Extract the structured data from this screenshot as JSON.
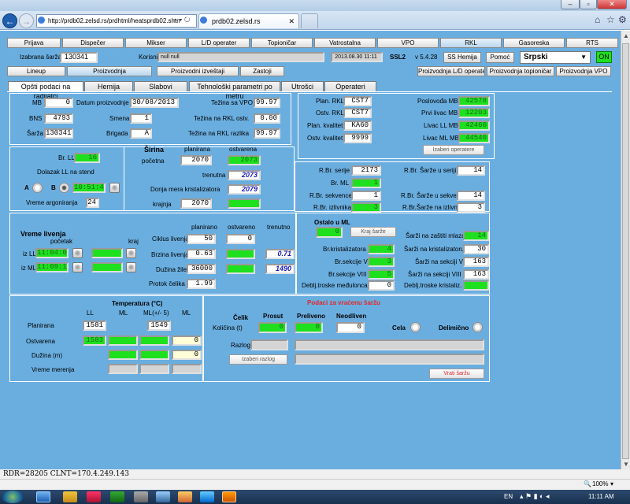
{
  "browser": {
    "url": "http://prdb02.zelsd.rs/prdhtml/heatsprdb02.shtn",
    "tab_title": "prdb02.zelsd.rs",
    "minimize": "–",
    "maximize": "▫",
    "close": "✕"
  },
  "topmenu": [
    "Prijava",
    "Dispečer",
    "Mikser",
    "L/D operater",
    "Topioničar",
    "Vatrostalna",
    "VPO",
    "RKL",
    "Gasoreska",
    "RTS"
  ],
  "header": {
    "izabrana_sarza_label": "Izabrana šarža",
    "izabrana_sarza": "130341",
    "korisnik_label": "Korisnik",
    "korisnik": "null null",
    "datetime": "2013.08.30 11:11",
    "system": "SSL2",
    "version": "v 5.4.28",
    "ss_hemija": "SS Hemija",
    "pomoc": "Pomoć",
    "language": "Srpski",
    "status": "ON"
  },
  "menu2": [
    "Lineup",
    "Proizvodnja",
    "Proizvodni izveštaji",
    "Zastoji"
  ],
  "menu2_right": [
    "Proizvodnja L/D operater",
    "Proizvodnja topioničar",
    "Proizvodnja VPO"
  ],
  "subtabs": [
    "Opšti podaci na radijalci",
    "Hemija",
    "Slabovi",
    "Tehnološki parametri po metru",
    "Utrošci",
    "Operateri"
  ],
  "general": {
    "mb_label": "MB",
    "mb": "0",
    "datum_label": "Datum proizvodnje",
    "datum": "30/08/2013",
    "tezina_vpo_label": "Težina sa VPO",
    "tezina_vpo": "99.97",
    "bns_label": "BNS",
    "bns": "4793",
    "smena_label": "Smena",
    "smena": "1",
    "tezina_rkl_ostv_label": "Težina na RKL ostv.",
    "tezina_rkl_ostv": "0.00",
    "sarza_label": "Šarža",
    "sarza": "130341",
    "brigada_label": "Brigada",
    "brigada": "A",
    "tezina_rkl_razlika_label": "Težina na RKL razlika",
    "tezina_rkl_razlika": "99.97"
  },
  "plan": {
    "plan_rkl_label": "Plan. RKL",
    "plan_rkl": "CST7",
    "ostv_rkl_label": "Ostv. RKL",
    "ostv_rkl": "CST7",
    "plan_kvalitet_label": "Plan. kvalitet",
    "plan_kvalitet": "KA60",
    "ostv_kvalitet_label": "Ostv. kvalitet",
    "ostv_kvalitet": "9999",
    "poslovodja_label": "Poslovođa MB",
    "poslovodja": "42578",
    "prvi_livac_label": "Prvi livac MB",
    "prvi_livac": "12203",
    "livac_ll_label": "Livac LL MB",
    "livac_ll": "42460",
    "livac_ml_label": "Livac ML MB",
    "livac_ml": "44540",
    "izaberi_operatere": "Izaberi operatere"
  },
  "stend": {
    "br_ll_label": "Br. LL",
    "br_ll": "16",
    "dolazak_label": "Dolazak LL na stend",
    "a_label": "A",
    "b_label": "B",
    "dolazak_time": "10:51:44",
    "vreme_argon_label": "Vreme argoniranja",
    "vreme_argon": "24"
  },
  "sirina": {
    "title": "Širina",
    "planirana_label": "planirana",
    "ostvarena_label": "ostvarena",
    "pocetna_label": "početna",
    "pocetna_plan": "2070",
    "pocetna_ostv": "2073",
    "trenutna_label": "trenutna",
    "trenutna": "2073",
    "donja_label": "Donja mera kristalizatora",
    "donja": "2079",
    "krajnja_label": "krajnja",
    "krajnja_plan": "2070",
    "krajnja_ostv": ""
  },
  "serije": {
    "rbr_serije_label": "R.Br. serije",
    "rbr_serije": "2173",
    "rbr_sarze_seriji_label": "R.Br. Šarže u seriji",
    "rbr_sarze_seriji": "14",
    "br_ml_label": "Br. ML",
    "br_ml": "1",
    "rbr_sekvence_label": "R.Br. sekvence",
    "rbr_sekvence": "1",
    "rbr_sarze_sekvenci_label": "R.Br. Šarže u sekvenci",
    "rbr_sarze_sekvenci": "14",
    "rbr_izlivnika_label": "R.Br. izlivnika",
    "rbr_izlivnika": "3",
    "rbr_sarze_izlivniku_label": "R.Br.Šarže na izlivniku",
    "rbr_sarze_izlivniku": "3"
  },
  "livenje": {
    "title": "Vreme livenja",
    "pocetak_label": "početak",
    "kraj_label": "kraj",
    "iz_ll_label": "iz LL",
    "iz_ll": "11:04:05",
    "iz_ll_kraj": "",
    "iz_ml_label": "iz ML",
    "iz_ml": "11:09:15",
    "iz_ml_kraj": "",
    "planirano_label": "planirano",
    "ostvareno_label": "ostvareno",
    "trenutno_label": "trenutno",
    "ciklus_label": "Ciklus livenja",
    "ciklus_plan": "50",
    "ciklus_ostv": "0",
    "brzina_label": "Brzina livenja",
    "brzina_plan": "0.63",
    "brzina_ostv": "",
    "brzina_tren": "0.71",
    "duzina_label": "Dužina žile",
    "duzina_plan": "36000",
    "duzina_ostv": "",
    "duzina_tren": "1490",
    "protok_label": "Protok čelika",
    "protok": "1.99"
  },
  "ostalo": {
    "title": "Ostalo u ML",
    "value": "0",
    "kraj_sarze": "Kraj šarže",
    "br_kristalizatora_label": "Br.kristalizatora",
    "br_kristalizatora": "4",
    "br_sekcije_v_label": "Br.sekcije V",
    "br_sekcije_v": "3",
    "br_sekcije_viii_label": "Br.sekcije VIII",
    "br_sekcije_viii": "5",
    "debljina_medjulonca_label": "Deblj.troske međulonca",
    "debljina_medjulonca": "0",
    "sarzi_zastiti_label": "Šarži na zaštiti mlaza",
    "sarzi_zastiti": "14",
    "sarzi_kristalizatoru_label": "Šarži na kristalizatoru",
    "sarzi_kristalizatoru": "30",
    "sarzi_sekciji_v_label": "Šarži na sekciji V",
    "sarzi_sekciji_v": "163",
    "sarzi_sekciji_viii_label": "Šarži na sekciji VIII",
    "sarzi_sekciji_viii": "163",
    "debljina_kristaliz_label": "Deblj.troske kristaliz.",
    "debljina_kristaliz": ""
  },
  "temperatura": {
    "title": "Temperatura (°C)",
    "ll_label": "LL",
    "ml_label": "ML",
    "ml_pm_label": "ML(+/- 5)",
    "ml2_label": "ML",
    "planirana_label": "Planirana",
    "planirana_ll": "1581",
    "planirana_ml_pm": "1549",
    "ostvarena_label": "Ostvarena",
    "ostvarena_ll": "1583",
    "ostvarena_ml": "",
    "ostvarena_ml_pm": "",
    "ostvarena_ml2": "0",
    "duzina_label": "Dužina (m)",
    "duzina_ml2": "0",
    "vreme_merenja_label": "Vreme merenja"
  },
  "vracena": {
    "title": "Podaci za vraćenu šaržu",
    "celik_label": "Čelik",
    "prosut_label": "Prosut",
    "preliveno_label": "Preliveno",
    "neodliven_label": "Neodliven",
    "kolicina_label": "Količina (t)",
    "prosut": "0",
    "preliveno": "0",
    "neodliven": "0",
    "cela_label": "Cela",
    "delimicno_label": "Delimično",
    "razlog_label": "Razlog",
    "izaberi_razlog": "Izaberi razlog",
    "vrati_sarzu": "Vrati šaržu"
  },
  "statusbar": "RDR=28205 CLNT=170.4.249.143",
  "zoom": "100%",
  "taskbar": {
    "lang": "EN",
    "time": "11:11 AM"
  },
  "colors": {
    "background": "#6aaee0",
    "green_field": "#1ee01e",
    "accent_red": "#e0282b"
  }
}
